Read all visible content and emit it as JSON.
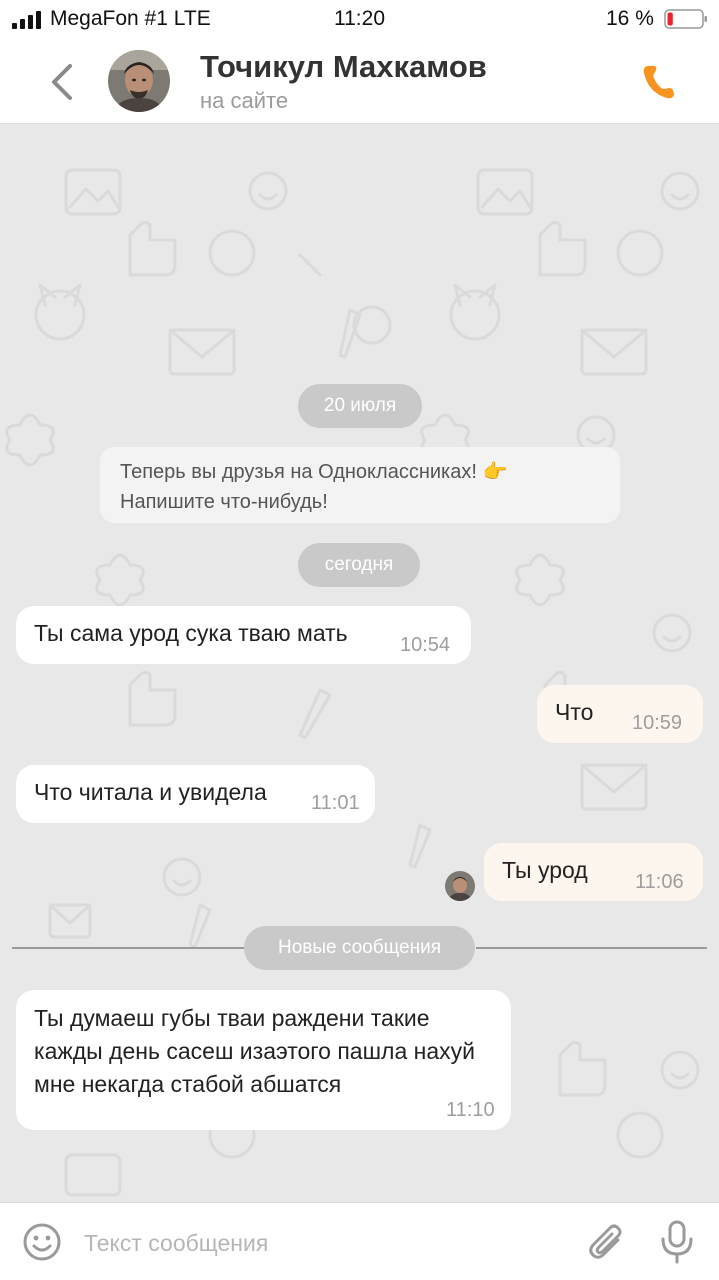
{
  "status_bar": {
    "carrier": "MegaFon #1  LTE",
    "time": "11:20",
    "battery_percent": "16 %",
    "battery_level": 0.16
  },
  "header": {
    "contact_name": "Точикул Махкамов",
    "contact_status": "на сайте",
    "accent_color": "#f7931e"
  },
  "chat": {
    "date_1": "20 июля",
    "system_note_line1": "Теперь вы друзья на Одноклассниках! 👉",
    "system_note_line2": "Напишите что-нибудь!",
    "date_2": "сегодня",
    "messages": [
      {
        "direction": "in",
        "text": "Ты сама урод сука тваю мать",
        "time": "10:54"
      },
      {
        "direction": "out",
        "text": "Что",
        "time": "10:59"
      },
      {
        "direction": "in",
        "text": "Что читала и увидела",
        "time": "11:01"
      },
      {
        "direction": "out",
        "text": "Ты урод",
        "time": "11:06"
      },
      {
        "direction": "in",
        "text": "Ты думаеш губы тваи раждени такие кажды день сасеш изаэтого пашла нахуй  мне некагда стабой абшатся",
        "time": "11:10"
      }
    ],
    "new_messages_label": "Новые сообщения"
  },
  "composer": {
    "placeholder": "Текст сообщения"
  }
}
